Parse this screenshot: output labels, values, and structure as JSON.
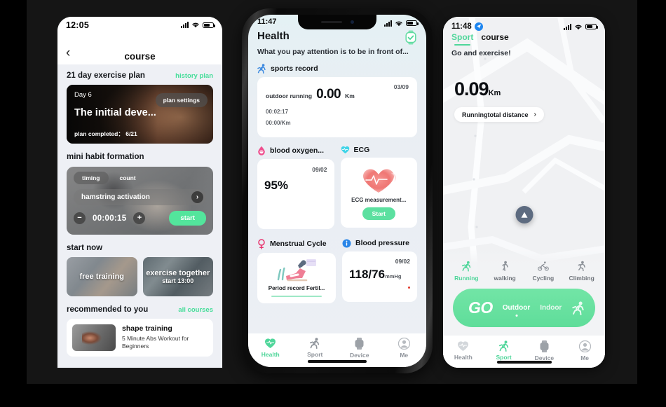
{
  "phone1": {
    "status": {
      "time": "12:05"
    },
    "nav": {
      "back_icon": "chevron-left-icon",
      "title": "course"
    },
    "sections": {
      "plan": {
        "title": "21 day exercise plan",
        "link": "history plan"
      },
      "habit": {
        "title": "mini habit formation"
      },
      "start_now": {
        "title": "start now"
      },
      "recommended": {
        "title": "recommended to you",
        "link": "all courses"
      }
    },
    "plan_card": {
      "day": "Day 6",
      "settings": "plan settings",
      "headline": "The initial deve...",
      "completed_label": "plan completed：",
      "completed_value": "6/21"
    },
    "habit_card": {
      "tab_timing": "timing",
      "tab_count": "count",
      "exercise": "hamstring activation",
      "chevron": "chevron-right-icon",
      "minus": "−",
      "plus": "+",
      "timer": "00:00:15",
      "start": "start"
    },
    "start_cards": [
      {
        "label": "free training",
        "sub": ""
      },
      {
        "label": "exercise together",
        "sub": "start  13:00"
      }
    ],
    "recommend_card": {
      "title": "shape training",
      "subtitle": "5 Minute Abs Workout for Beginners"
    }
  },
  "phone2": {
    "status": {
      "time": "11:47"
    },
    "app_title": "Health",
    "watch_icon": "smartwatch-icon",
    "slogan": "What you pay attention is to be in front of...",
    "groups": {
      "sports": {
        "icon": "running-icon",
        "title": "sports record"
      },
      "blood_oxygen": {
        "icon": "blood-drop-icon",
        "title": "blood oxygen..."
      },
      "ecg": {
        "icon": "ecg-heart-icon",
        "title": "ECG"
      },
      "menstrual": {
        "icon": "female-symbol-icon",
        "title": "Menstrual Cycle"
      },
      "blood_pressure": {
        "icon": "info-circle-icon",
        "title": "Blood pressure"
      }
    },
    "sports_card": {
      "date": "03/09",
      "label": "outdoor running",
      "value": "0.00",
      "unit": "Km",
      "duration": "00:02:17",
      "pace": "00:00/Km"
    },
    "oxygen_card": {
      "date": "09/02",
      "value": "95%"
    },
    "ecg_card": {
      "text": "ECG measurement...",
      "button": "Start"
    },
    "menstrual_card": {
      "text": "Period record Fertil..."
    },
    "bp_card": {
      "date": "09/02",
      "value": "118/76",
      "unit": "mmHg"
    },
    "tabs": [
      {
        "label": "Health",
        "icon": "heart-icon",
        "active": true
      },
      {
        "label": "Sport",
        "icon": "running-icon",
        "active": false
      },
      {
        "label": "Device",
        "icon": "watch-icon",
        "active": false
      },
      {
        "label": "Me",
        "icon": "user-icon",
        "active": false
      }
    ]
  },
  "phone3": {
    "status": {
      "time": "11:48",
      "location_icon": "location-arrow-icon"
    },
    "tabs": [
      {
        "label": "Sport",
        "active": true
      },
      {
        "label": "course",
        "active": false
      }
    ],
    "prompt": "Go and exercise!",
    "distance": {
      "value": "0.09",
      "unit": "Km"
    },
    "pill": {
      "label": "Runningtotal distance",
      "chevron": "chevron-right-icon"
    },
    "marker_icon": "navigation-arrow-icon",
    "modes": [
      {
        "label": "Running",
        "icon": "running-icon",
        "active": true
      },
      {
        "label": "walking",
        "icon": "walking-icon",
        "active": false
      },
      {
        "label": "Cycling",
        "icon": "cycling-icon",
        "active": false
      },
      {
        "label": "Climbing",
        "icon": "climbing-icon",
        "active": false
      }
    ],
    "go_button": {
      "text": "GO",
      "outdoor": "Outdoor",
      "indoor": "Indoor",
      "icon": "running-icon"
    },
    "tabbar": [
      {
        "label": "Health",
        "icon": "heart-icon",
        "active": false
      },
      {
        "label": "Sport",
        "icon": "running-icon",
        "active": true
      },
      {
        "label": "Device",
        "icon": "watch-icon",
        "active": false
      },
      {
        "label": "Me",
        "icon": "user-icon",
        "active": false
      }
    ]
  },
  "colors": {
    "accent_green": "#4fd69a",
    "button_green": "#5ce0a0",
    "blue": "#1e86f0",
    "pink": "#e8538f",
    "red": "#e33b2e"
  }
}
